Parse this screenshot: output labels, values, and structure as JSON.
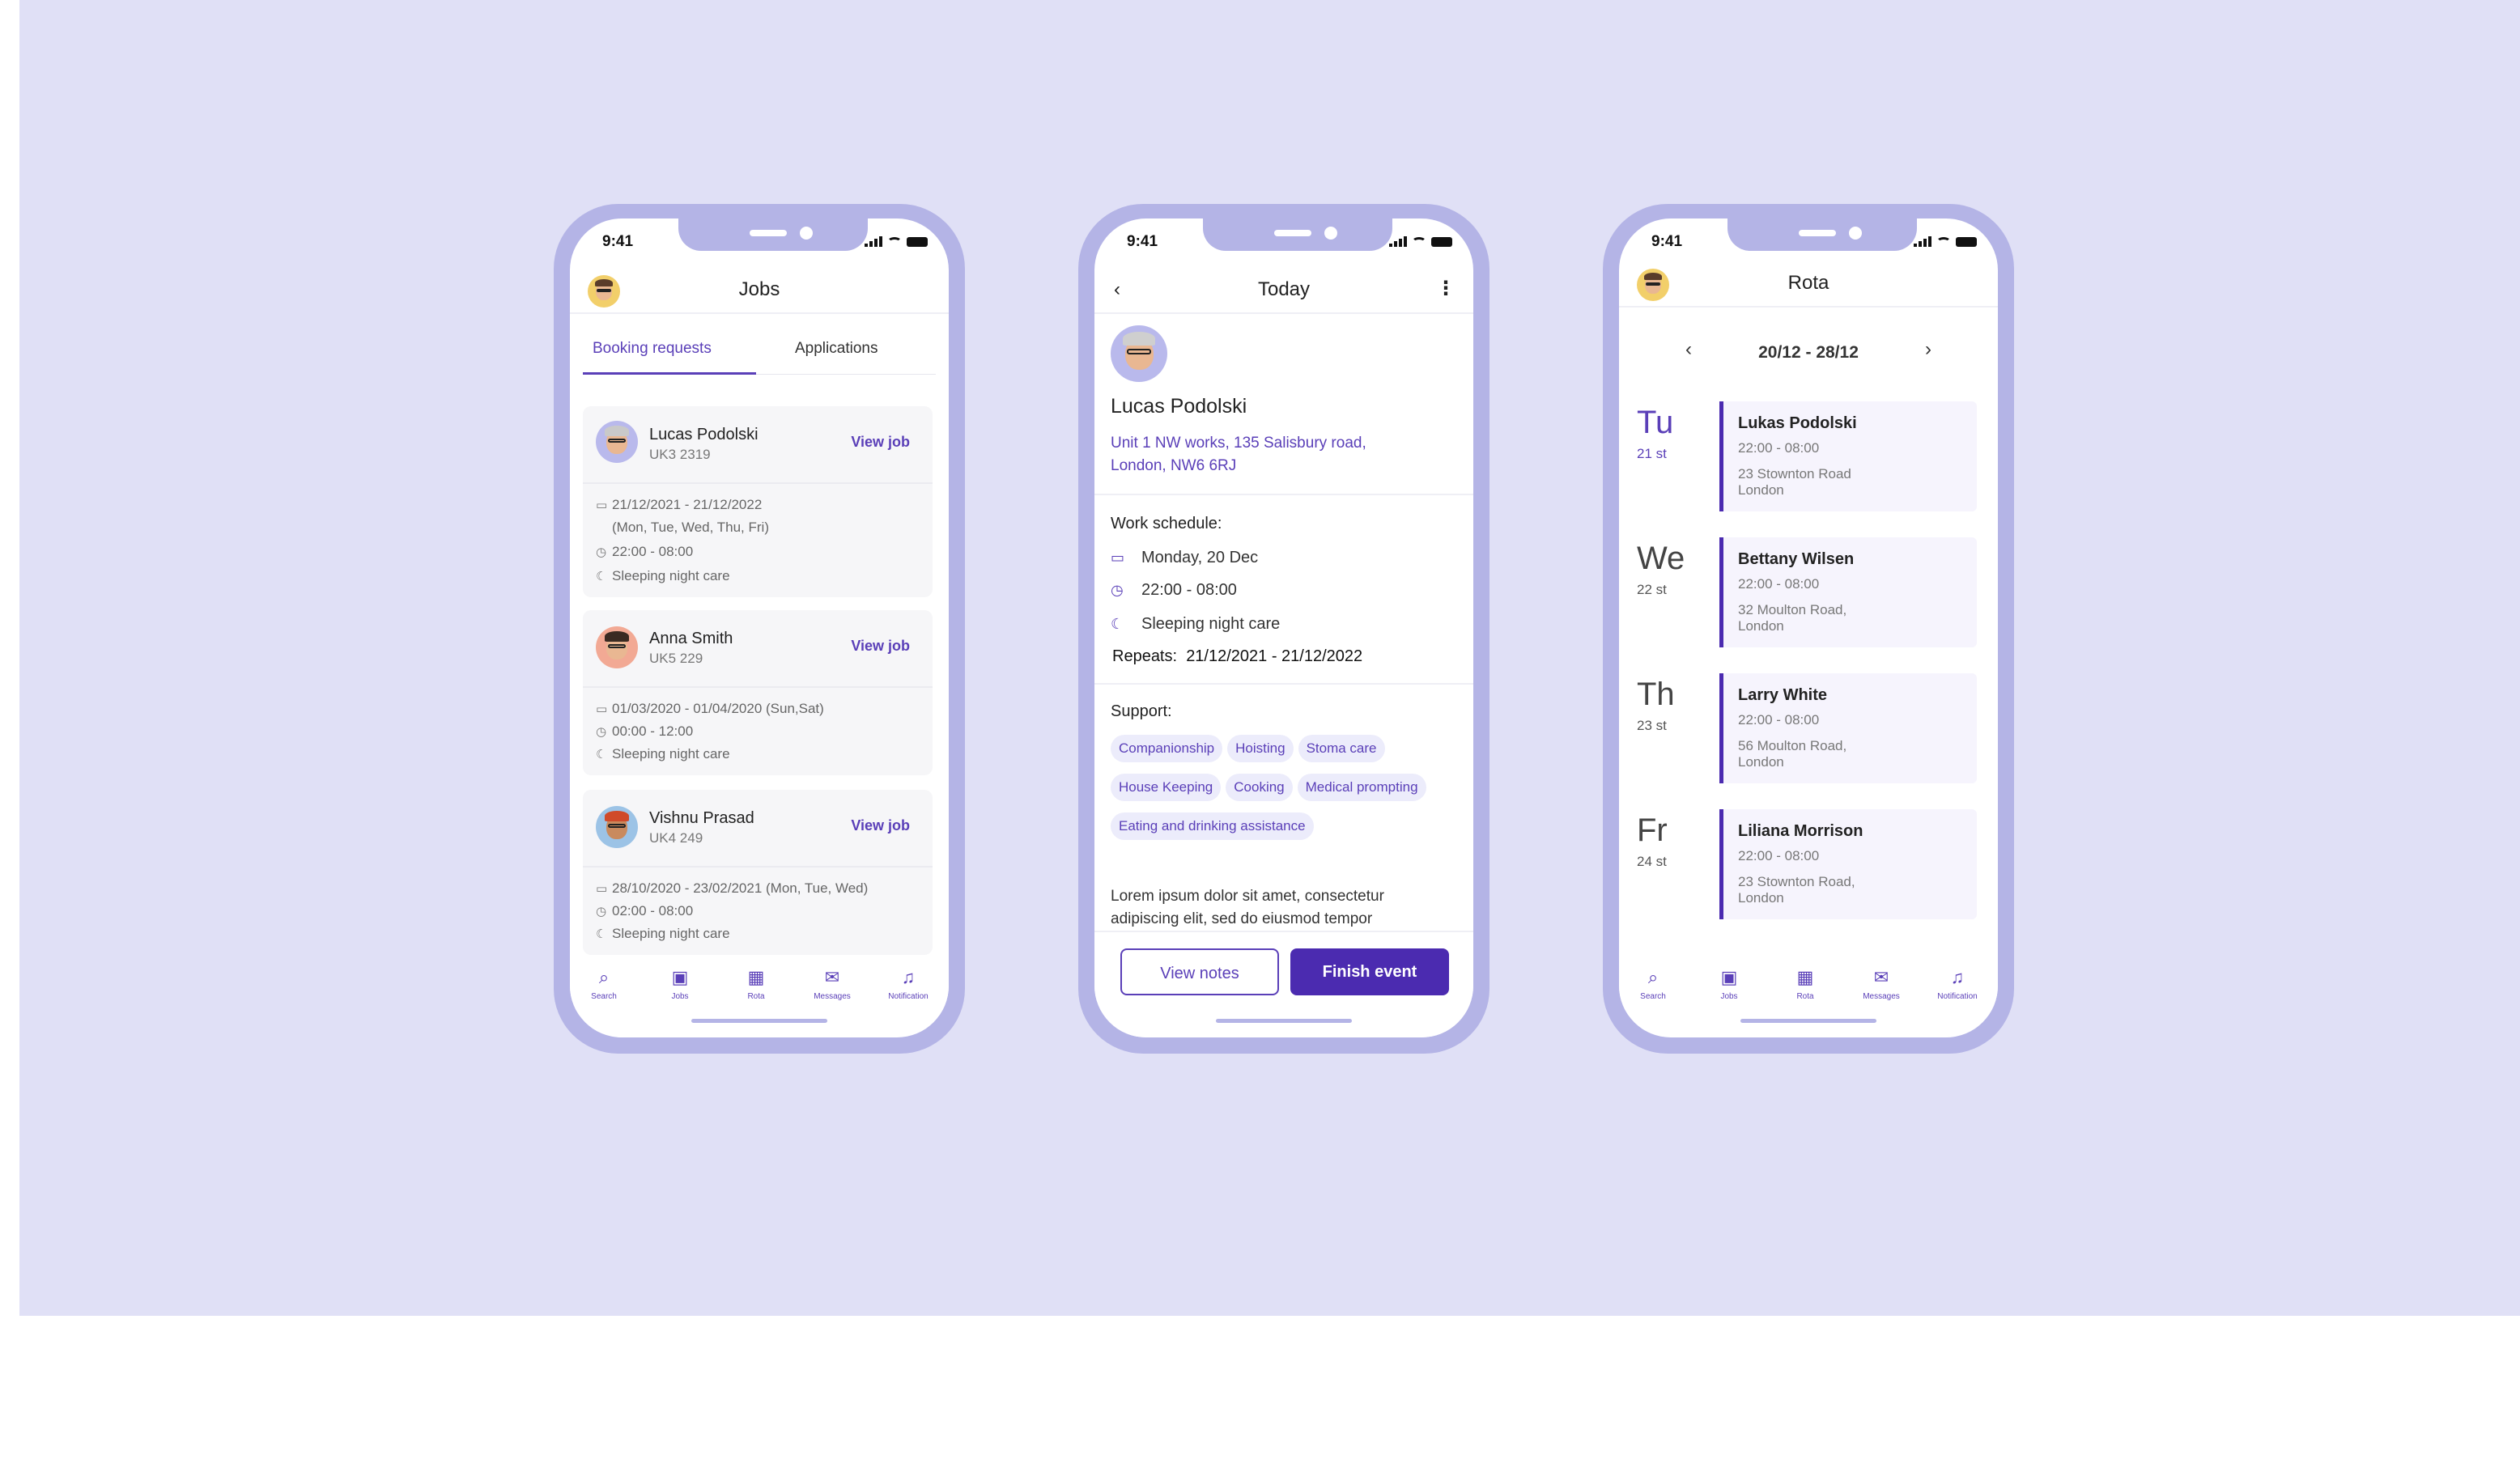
{
  "status_time": "9:41",
  "jobs_screen": {
    "title": "Jobs",
    "tabs": [
      "Booking requests",
      "Applications"
    ],
    "cards": [
      {
        "name": "Lucas Podolski",
        "id": "UK3 2319",
        "action": "View job",
        "date": "21/12/2021 - 21/12/2022",
        "days": "(Mon, Tue, Wed, Thu, Fri)",
        "time": "22:00 - 08:00",
        "type": "Sleeping night care"
      },
      {
        "name": "Anna Smith",
        "id": "UK5 229",
        "action": "View job",
        "date": "01/03/2020 - 01/04/2020 (Sun,Sat)",
        "time": "00:00 - 12:00",
        "type": "Sleeping night care"
      },
      {
        "name": "Vishnu Prasad",
        "id": "UK4 249",
        "action": "View job",
        "date": "28/10/2020 - 23/02/2021 (Mon, Tue, Wed)",
        "time": "02:00 - 08:00",
        "type": "Sleeping night care"
      }
    ]
  },
  "nav": {
    "items": [
      "Search",
      "Jobs",
      "Rota",
      "Messages",
      "Notification"
    ]
  },
  "event_screen": {
    "title": "Today",
    "name": "Lucas Podolski",
    "address_line1": "Unit 1 NW works, 135 Salisbury road,",
    "address_line2": "London, NW6 6RJ",
    "schedule_heading": "Work schedule:",
    "date": "Monday, 20 Dec",
    "time": "22:00 - 08:00",
    "type": "Sleeping night care",
    "repeats_label": "Repeats:",
    "repeats_value": "21/12/2021 - 21/12/2022",
    "support_heading": "Support:",
    "support_tags": [
      "Companionship",
      "Hoisting",
      "Stoma care",
      "House Keeping",
      "Cooking",
      "Medical prompting",
      "Eating and drinking assistance"
    ],
    "notes_line1": "Lorem ipsum dolor sit amet, consectetur",
    "notes_line2": "adipiscing elit, sed do eiusmod tempor",
    "btn_notes": "View notes",
    "btn_finish": "Finish event"
  },
  "rota_screen": {
    "title": "Rota",
    "week": "20/12 - 28/12",
    "days": [
      {
        "day": "Tu",
        "date": "21 st",
        "name": "Lukas Podolski",
        "time": "22:00 - 08:00",
        "addr1": "23 Stownton Road",
        "addr2": "London"
      },
      {
        "day": "We",
        "date": "22 st",
        "name": "Bettany Wilsen",
        "time": "22:00 - 08:00",
        "addr1": "32 Moulton Road,",
        "addr2": "London"
      },
      {
        "day": "Th",
        "date": "23 st",
        "name": "Larry White",
        "time": "22:00 - 08:00",
        "addr1": "56 Moulton Road,",
        "addr2": "London"
      },
      {
        "day": "Fr",
        "date": "24 st",
        "name": "Liliana Morrison",
        "time": "22:00 - 08:00",
        "addr1": "23 Stownton Road,",
        "addr2": "London"
      }
    ]
  },
  "colors": {
    "accent": "#5a3fb8",
    "frame": "#b4b4e6",
    "background": "#e0e0f6"
  }
}
